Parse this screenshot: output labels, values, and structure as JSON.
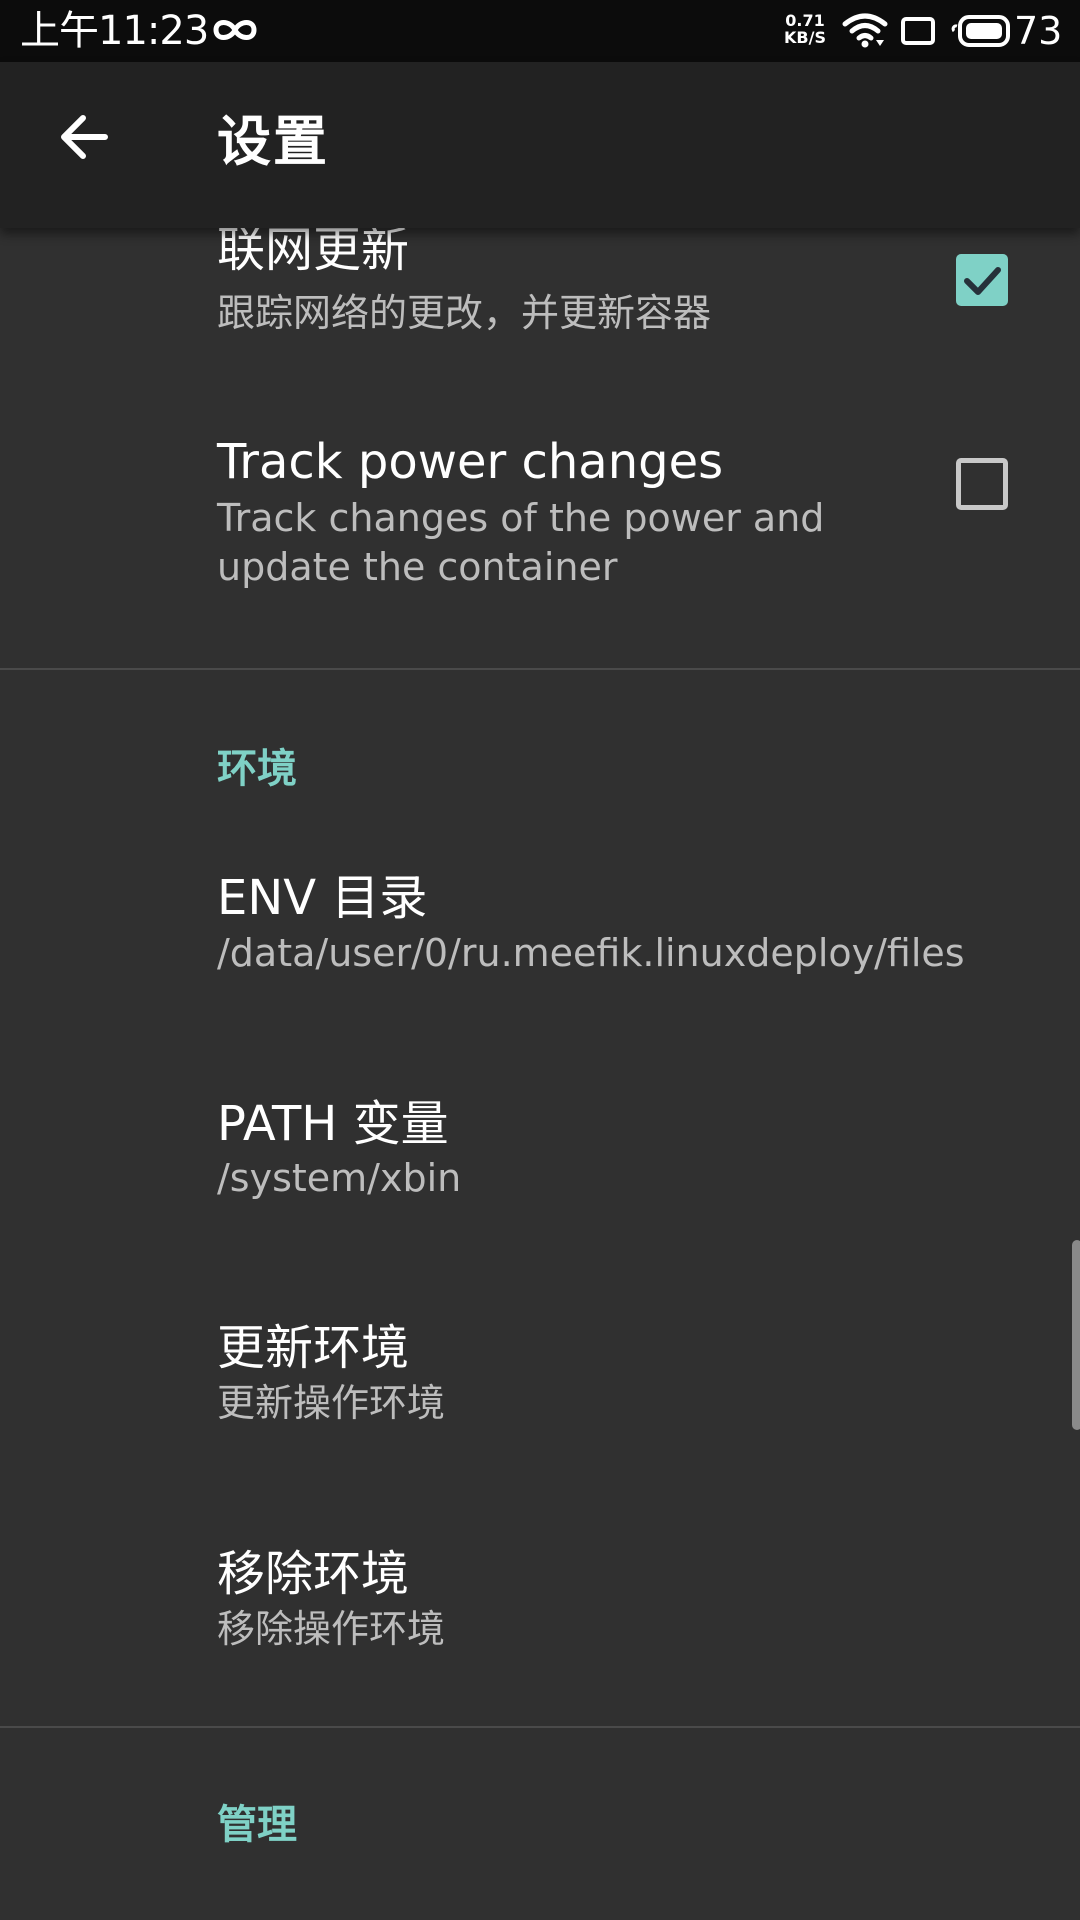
{
  "status_bar": {
    "time": "上午11:23",
    "net_speed_value": "0.71",
    "net_speed_unit": "KB/S",
    "battery_level": "73",
    "icons": [
      "infinity-icon",
      "wifi-icon",
      "screen-icon",
      "battery-icon"
    ]
  },
  "toolbar": {
    "title": "设置",
    "back_icon": "arrow-back-icon"
  },
  "preferences": {
    "network_update": {
      "title": "联网更新",
      "summary": "跟踪网络的更改，并更新容器",
      "checked": true
    },
    "track_power": {
      "title": "Track power changes",
      "summary": "Track changes of the power and update the container",
      "checked": false
    }
  },
  "categories": {
    "environment": "环境",
    "management": "管理"
  },
  "environment_items": [
    {
      "title": "ENV 目录",
      "summary": "/data/user/0/ru.meefik.linuxdeploy/files"
    },
    {
      "title": "PATH 变量",
      "summary": "/system/xbin"
    },
    {
      "title": "更新环境",
      "summary": "更新操作环境"
    },
    {
      "title": "移除环境",
      "summary": "移除操作环境"
    }
  ],
  "colors": {
    "accent": "#7fd1c6",
    "background": "#303030",
    "toolbar": "#222222",
    "status_bar": "#0c0c0c"
  }
}
